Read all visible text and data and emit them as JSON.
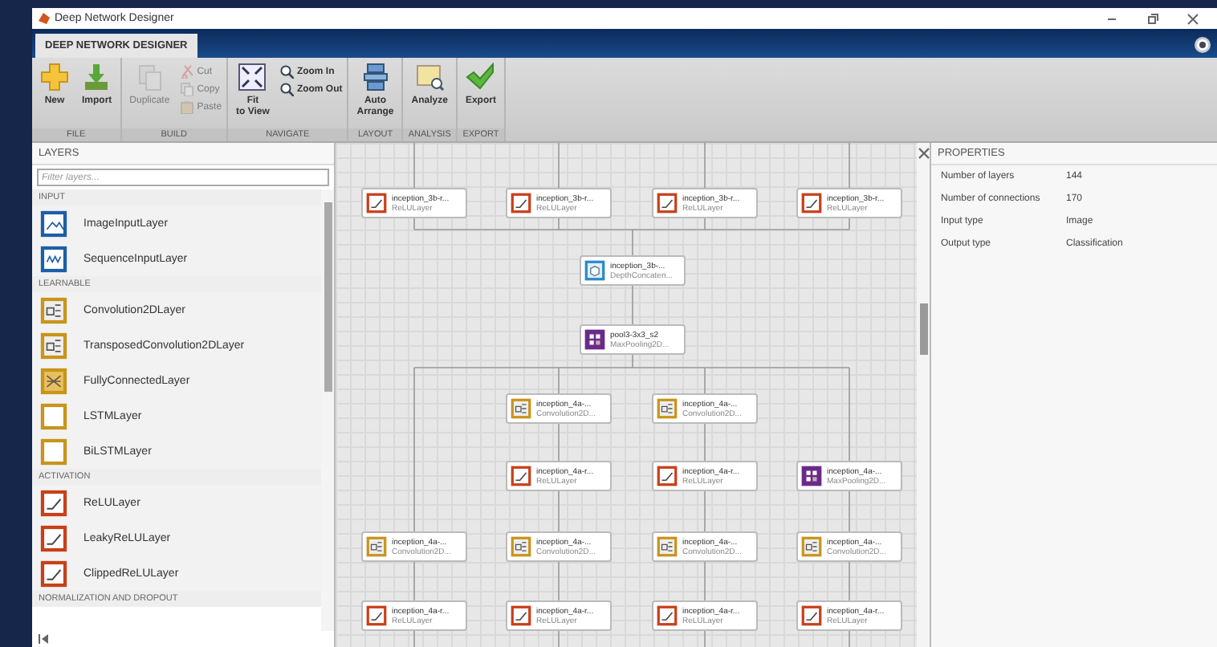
{
  "window": {
    "title": "Deep Network Designer"
  },
  "tabs": [
    {
      "label": "DEEP NETWORK DESIGNER",
      "selected": true
    }
  ],
  "toolstrip": {
    "sections": [
      {
        "label": "FILE",
        "items": [
          {
            "kind": "large",
            "label": "New",
            "disabled": false
          },
          {
            "kind": "large",
            "label": "Import",
            "disabled": false
          }
        ]
      },
      {
        "label": "BUILD",
        "items": [
          {
            "kind": "large",
            "label": "Duplicate",
            "disabled": true
          },
          {
            "kind": "stack",
            "items": [
              {
                "label": "Cut",
                "disabled": true
              },
              {
                "label": "Copy",
                "disabled": true
              },
              {
                "label": "Paste",
                "disabled": true
              }
            ]
          }
        ]
      },
      {
        "label": "NAVIGATE",
        "items": [
          {
            "kind": "large",
            "label": "Fit\nto View",
            "disabled": false
          },
          {
            "kind": "stack",
            "items": [
              {
                "label": "Zoom In",
                "disabled": false
              },
              {
                "label": "Zoom Out",
                "disabled": false
              }
            ]
          }
        ]
      },
      {
        "label": "LAYOUT",
        "items": [
          {
            "kind": "large",
            "label": "Auto\nArrange",
            "disabled": false
          }
        ]
      },
      {
        "label": "ANALYSIS",
        "items": [
          {
            "kind": "large",
            "label": "Analyze",
            "disabled": false
          }
        ]
      },
      {
        "label": "EXPORT",
        "items": [
          {
            "kind": "large",
            "label": "Export",
            "disabled": false
          }
        ]
      }
    ]
  },
  "layers_panel": {
    "title": "LAYERS",
    "filter": {
      "placeholder": "Filter layers..."
    },
    "groups": [
      {
        "label": "INPUT",
        "items": [
          {
            "label": "ImageInputLayer",
            "kind": "input"
          },
          {
            "label": "SequenceInputLayer",
            "kind": "sequence"
          }
        ]
      },
      {
        "label": "LEARNABLE",
        "items": [
          {
            "label": "Convolution2DLayer",
            "kind": "conv"
          },
          {
            "label": "TransposedConvolution2DLayer",
            "kind": "conv"
          },
          {
            "label": "FullyConnectedLayer",
            "kind": "fc"
          },
          {
            "label": "LSTMLayer",
            "kind": "lstm"
          },
          {
            "label": "BiLSTMLayer",
            "kind": "lstm"
          }
        ]
      },
      {
        "label": "ACTIVATION",
        "items": [
          {
            "label": "ReLULayer",
            "kind": "relu"
          },
          {
            "label": "LeakyReLULayer",
            "kind": "relu"
          },
          {
            "label": "ClippedReLULayer",
            "kind": "relu"
          }
        ]
      },
      {
        "label": "NORMALIZATION AND DROPOUT"
      }
    ]
  },
  "network": {
    "nodes": [
      {
        "name": "inception_3b-r...",
        "type": "ReLULayer",
        "kind": "relu"
      },
      {
        "name": "inception_3b-r...",
        "type": "ReLULayer",
        "kind": "relu"
      },
      {
        "name": "inception_3b-r...",
        "type": "ReLULayer",
        "kind": "relu"
      },
      {
        "name": "inception_3b-r...",
        "type": "ReLULayer",
        "kind": "relu"
      },
      {
        "name": "inception_3b-...",
        "type": "DepthConcaten...",
        "kind": "concat"
      },
      {
        "name": "pool3-3x3_s2",
        "type": "MaxPooling2D...",
        "kind": "maxpool"
      },
      {
        "name": "inception_4a-...",
        "type": "Convolution2D...",
        "kind": "conv"
      },
      {
        "name": "inception_4a-...",
        "type": "Convolution2D...",
        "kind": "conv"
      },
      {
        "name": "inception_4a-r...",
        "type": "ReLULayer",
        "kind": "relu"
      },
      {
        "name": "inception_4a-r...",
        "type": "ReLULayer",
        "kind": "relu"
      },
      {
        "name": "inception_4a-...",
        "type": "MaxPooling2D...",
        "kind": "maxpool"
      },
      {
        "name": "inception_4a-...",
        "type": "Convolution2D...",
        "kind": "conv"
      },
      {
        "name": "inception_4a-...",
        "type": "Convolution2D...",
        "kind": "conv"
      },
      {
        "name": "inception_4a-...",
        "type": "Convolution2D...",
        "kind": "conv"
      },
      {
        "name": "inception_4a-...",
        "type": "Convolution2D...",
        "kind": "conv"
      },
      {
        "name": "inception_4a-r...",
        "type": "ReLULayer",
        "kind": "relu"
      },
      {
        "name": "inception_4a-r...",
        "type": "ReLULayer",
        "kind": "relu"
      },
      {
        "name": "inception_4a-r...",
        "type": "ReLULayer",
        "kind": "relu"
      },
      {
        "name": "inception_4a-r...",
        "type": "ReLULayer",
        "kind": "relu"
      }
    ]
  },
  "properties": {
    "title": "PROPERTIES",
    "rows": [
      {
        "label": "Number of layers",
        "value": "144"
      },
      {
        "label": "Number of connections",
        "value": "170"
      },
      {
        "label": "Input type",
        "value": "Image"
      },
      {
        "label": "Output type",
        "value": "Classification"
      }
    ]
  }
}
